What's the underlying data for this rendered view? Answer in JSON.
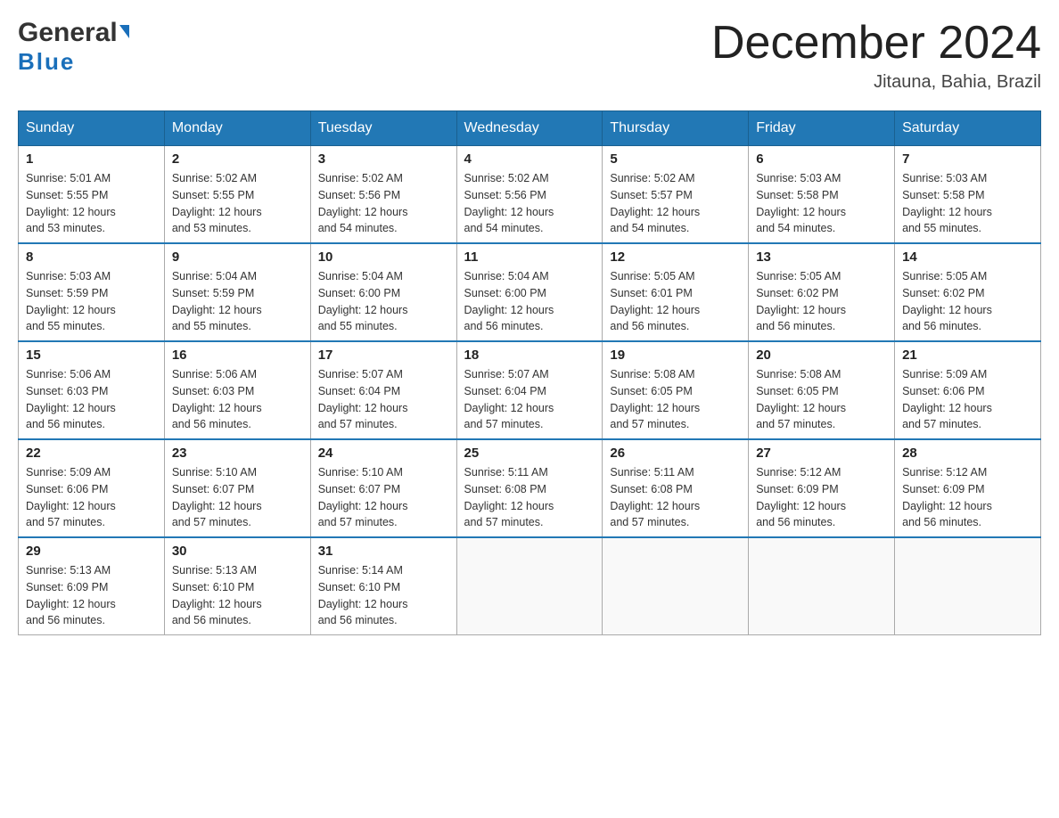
{
  "logo": {
    "general": "General",
    "blue": "Blue",
    "triangle": "▲"
  },
  "title": "December 2024",
  "location": "Jitauna, Bahia, Brazil",
  "weekdays": [
    "Sunday",
    "Monday",
    "Tuesday",
    "Wednesday",
    "Thursday",
    "Friday",
    "Saturday"
  ],
  "weeks": [
    [
      {
        "day": "1",
        "sunrise": "5:01 AM",
        "sunset": "5:55 PM",
        "daylight": "12 hours and 53 minutes."
      },
      {
        "day": "2",
        "sunrise": "5:02 AM",
        "sunset": "5:55 PM",
        "daylight": "12 hours and 53 minutes."
      },
      {
        "day": "3",
        "sunrise": "5:02 AM",
        "sunset": "5:56 PM",
        "daylight": "12 hours and 54 minutes."
      },
      {
        "day": "4",
        "sunrise": "5:02 AM",
        "sunset": "5:56 PM",
        "daylight": "12 hours and 54 minutes."
      },
      {
        "day": "5",
        "sunrise": "5:02 AM",
        "sunset": "5:57 PM",
        "daylight": "12 hours and 54 minutes."
      },
      {
        "day": "6",
        "sunrise": "5:03 AM",
        "sunset": "5:58 PM",
        "daylight": "12 hours and 54 minutes."
      },
      {
        "day": "7",
        "sunrise": "5:03 AM",
        "sunset": "5:58 PM",
        "daylight": "12 hours and 55 minutes."
      }
    ],
    [
      {
        "day": "8",
        "sunrise": "5:03 AM",
        "sunset": "5:59 PM",
        "daylight": "12 hours and 55 minutes."
      },
      {
        "day": "9",
        "sunrise": "5:04 AM",
        "sunset": "5:59 PM",
        "daylight": "12 hours and 55 minutes."
      },
      {
        "day": "10",
        "sunrise": "5:04 AM",
        "sunset": "6:00 PM",
        "daylight": "12 hours and 55 minutes."
      },
      {
        "day": "11",
        "sunrise": "5:04 AM",
        "sunset": "6:00 PM",
        "daylight": "12 hours and 56 minutes."
      },
      {
        "day": "12",
        "sunrise": "5:05 AM",
        "sunset": "6:01 PM",
        "daylight": "12 hours and 56 minutes."
      },
      {
        "day": "13",
        "sunrise": "5:05 AM",
        "sunset": "6:02 PM",
        "daylight": "12 hours and 56 minutes."
      },
      {
        "day": "14",
        "sunrise": "5:05 AM",
        "sunset": "6:02 PM",
        "daylight": "12 hours and 56 minutes."
      }
    ],
    [
      {
        "day": "15",
        "sunrise": "5:06 AM",
        "sunset": "6:03 PM",
        "daylight": "12 hours and 56 minutes."
      },
      {
        "day": "16",
        "sunrise": "5:06 AM",
        "sunset": "6:03 PM",
        "daylight": "12 hours and 56 minutes."
      },
      {
        "day": "17",
        "sunrise": "5:07 AM",
        "sunset": "6:04 PM",
        "daylight": "12 hours and 57 minutes."
      },
      {
        "day": "18",
        "sunrise": "5:07 AM",
        "sunset": "6:04 PM",
        "daylight": "12 hours and 57 minutes."
      },
      {
        "day": "19",
        "sunrise": "5:08 AM",
        "sunset": "6:05 PM",
        "daylight": "12 hours and 57 minutes."
      },
      {
        "day": "20",
        "sunrise": "5:08 AM",
        "sunset": "6:05 PM",
        "daylight": "12 hours and 57 minutes."
      },
      {
        "day": "21",
        "sunrise": "5:09 AM",
        "sunset": "6:06 PM",
        "daylight": "12 hours and 57 minutes."
      }
    ],
    [
      {
        "day": "22",
        "sunrise": "5:09 AM",
        "sunset": "6:06 PM",
        "daylight": "12 hours and 57 minutes."
      },
      {
        "day": "23",
        "sunrise": "5:10 AM",
        "sunset": "6:07 PM",
        "daylight": "12 hours and 57 minutes."
      },
      {
        "day": "24",
        "sunrise": "5:10 AM",
        "sunset": "6:07 PM",
        "daylight": "12 hours and 57 minutes."
      },
      {
        "day": "25",
        "sunrise": "5:11 AM",
        "sunset": "6:08 PM",
        "daylight": "12 hours and 57 minutes."
      },
      {
        "day": "26",
        "sunrise": "5:11 AM",
        "sunset": "6:08 PM",
        "daylight": "12 hours and 57 minutes."
      },
      {
        "day": "27",
        "sunrise": "5:12 AM",
        "sunset": "6:09 PM",
        "daylight": "12 hours and 56 minutes."
      },
      {
        "day": "28",
        "sunrise": "5:12 AM",
        "sunset": "6:09 PM",
        "daylight": "12 hours and 56 minutes."
      }
    ],
    [
      {
        "day": "29",
        "sunrise": "5:13 AM",
        "sunset": "6:09 PM",
        "daylight": "12 hours and 56 minutes."
      },
      {
        "day": "30",
        "sunrise": "5:13 AM",
        "sunset": "6:10 PM",
        "daylight": "12 hours and 56 minutes."
      },
      {
        "day": "31",
        "sunrise": "5:14 AM",
        "sunset": "6:10 PM",
        "daylight": "12 hours and 56 minutes."
      },
      null,
      null,
      null,
      null
    ]
  ],
  "labels": {
    "sunrise": "Sunrise: ",
    "sunset": "Sunset: ",
    "daylight": "Daylight: "
  }
}
